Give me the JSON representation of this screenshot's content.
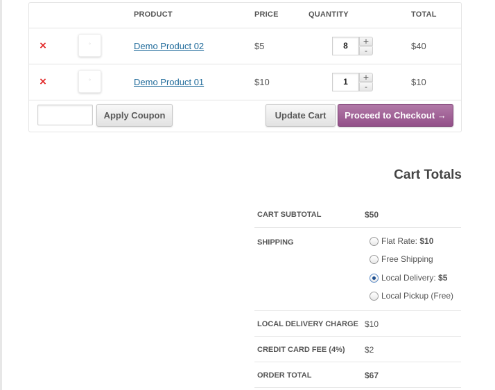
{
  "cart": {
    "headers": {
      "product": "PRODUCT",
      "price": "PRICE",
      "quantity": "QUANTITY",
      "total": "TOTAL"
    },
    "items": [
      {
        "remove": "×",
        "name": "Demo Product 02",
        "price": "$5",
        "quantity": "8",
        "total": "$40"
      },
      {
        "remove": "×",
        "name": "Demo Product 01",
        "price": "$10",
        "quantity": "1",
        "total": "$10"
      }
    ],
    "qty_plus": "+",
    "qty_minus": "-",
    "coupon_value": "",
    "apply_coupon": "Apply Coupon",
    "update_cart": "Update Cart",
    "proceed_checkout": "Proceed to Checkout →"
  },
  "totals": {
    "title": "Cart Totals",
    "subtotal_label": "CART SUBTOTAL",
    "subtotal_value": "$50",
    "shipping_label": "SHIPPING",
    "shipping_options": [
      {
        "label": "Flat Rate: ",
        "price": "$10",
        "selected": false
      },
      {
        "label": "Free Shipping",
        "price": "",
        "selected": false
      },
      {
        "label": "Local Delivery: ",
        "price": "$5",
        "selected": true
      },
      {
        "label": "Local Pickup (Free)",
        "price": "",
        "selected": false
      }
    ],
    "delivery_label": "LOCAL DELIVERY CHARGE",
    "delivery_value": "$10",
    "fee_label": "CREDIT CARD FEE (4%)",
    "fee_value": "$2",
    "order_label": "ORDER TOTAL",
    "order_value": "$67"
  },
  "colors": {
    "checkout_button": "#935089",
    "remove_icon": "#e01c1c",
    "product_link": "#1f6a9a",
    "radio_selected": "#1d4f8f"
  },
  "icons": {
    "remove": "remove-icon",
    "product_thumbnail": "placeholder-image-icon"
  }
}
